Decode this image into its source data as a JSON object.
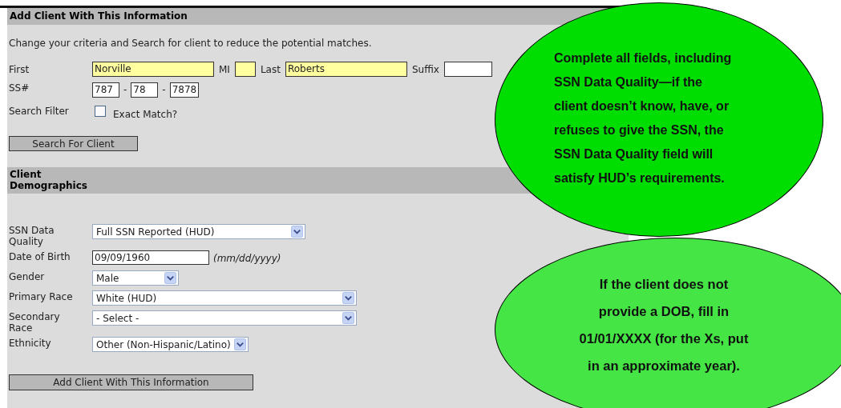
{
  "search_section": {
    "title": "Add Client With This Information",
    "instruction": "Change your criteria and Search for client to reduce the potential matches.",
    "name_fields": [
      {
        "label": "First",
        "value": "Norville"
      },
      {
        "label": "MI"
      },
      {
        "label": "Last",
        "value": "Roberts"
      },
      {
        "label": "Suffix"
      }
    ],
    "ssn": {
      "label": "SS#",
      "parts": [
        "787",
        "78",
        "7878"
      ],
      "separator": "-"
    },
    "search_filter": {
      "label": "Search Filter",
      "option": "Exact Match?",
      "checked": false
    },
    "search_button": "Search For Client"
  },
  "demographics": {
    "title": "Client Demographics",
    "fields": [
      {
        "kind": "select",
        "label": "SSN Data Quality",
        "value": "Full SSN Reported (HUD)"
      },
      {
        "kind": "text",
        "label": "Date of Birth",
        "value": "09/09/1960",
        "hint": "(mm/dd/yyyy)"
      },
      {
        "kind": "select",
        "label": "Gender",
        "value": "Male"
      },
      {
        "kind": "select",
        "label": "Primary Race",
        "value": "White (HUD)"
      },
      {
        "kind": "select",
        "label": "Secondary Race",
        "value": "- Select -"
      },
      {
        "kind": "select",
        "label": "Ethnicity",
        "value": "Other (Non-Hispanic/Latino)"
      }
    ],
    "add_button": "Add Client With This Information"
  },
  "callouts": [
    {
      "lines": [
        "Complete all fields, including",
        "SSN Data Quality—if the",
        "client doesn’t know, have, or",
        "refuses to give the SSN, the",
        "SSN Data Quality field will",
        "satisfy HUD’s requirements."
      ],
      "color": "#00dd00"
    },
    {
      "lines": [
        "If the client does not",
        "provide a DOB, fill in",
        "01/01/XXXX (for the Xs, put",
        "in an approximate year)."
      ],
      "color": "#44e544"
    }
  ]
}
